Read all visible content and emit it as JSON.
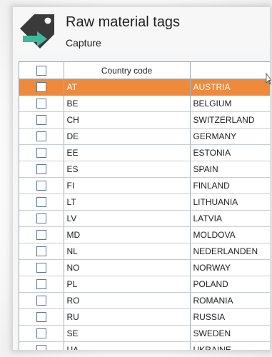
{
  "header": {
    "title": "Raw material tags",
    "subtitle": "Capture"
  },
  "grid": {
    "columns": [
      {
        "label": ""
      },
      {
        "label": "Country code"
      },
      {
        "label": ""
      }
    ],
    "selected_index": 0,
    "rows": [
      {
        "code": "AT",
        "name": "AUSTRIA"
      },
      {
        "code": "BE",
        "name": "BELGIUM"
      },
      {
        "code": "CH",
        "name": "SWITZERLAND"
      },
      {
        "code": "DE",
        "name": "GERMANY"
      },
      {
        "code": "EE",
        "name": "ESTONIA"
      },
      {
        "code": "ES",
        "name": "SPAIN"
      },
      {
        "code": "FI",
        "name": "FINLAND"
      },
      {
        "code": "LT",
        "name": "LITHUANIA"
      },
      {
        "code": "LV",
        "name": "LATVIA"
      },
      {
        "code": "MD",
        "name": "MOLDOVA"
      },
      {
        "code": "NL",
        "name": "NEDERLANDEN"
      },
      {
        "code": "NO",
        "name": "NORWAY"
      },
      {
        "code": "PL",
        "name": "POLAND"
      },
      {
        "code": "RO",
        "name": "ROMANIA"
      },
      {
        "code": "RU",
        "name": "RUSSIA"
      },
      {
        "code": "SE",
        "name": "SWEDEN"
      },
      {
        "code": "UA",
        "name": "UKRAINE"
      }
    ]
  },
  "colors": {
    "selection": "#ef8a3d",
    "tag_icon": "#3a3a3a",
    "arrow_icon": "#3fb99b"
  },
  "icons": {
    "app": "tag-arrow-icon"
  }
}
